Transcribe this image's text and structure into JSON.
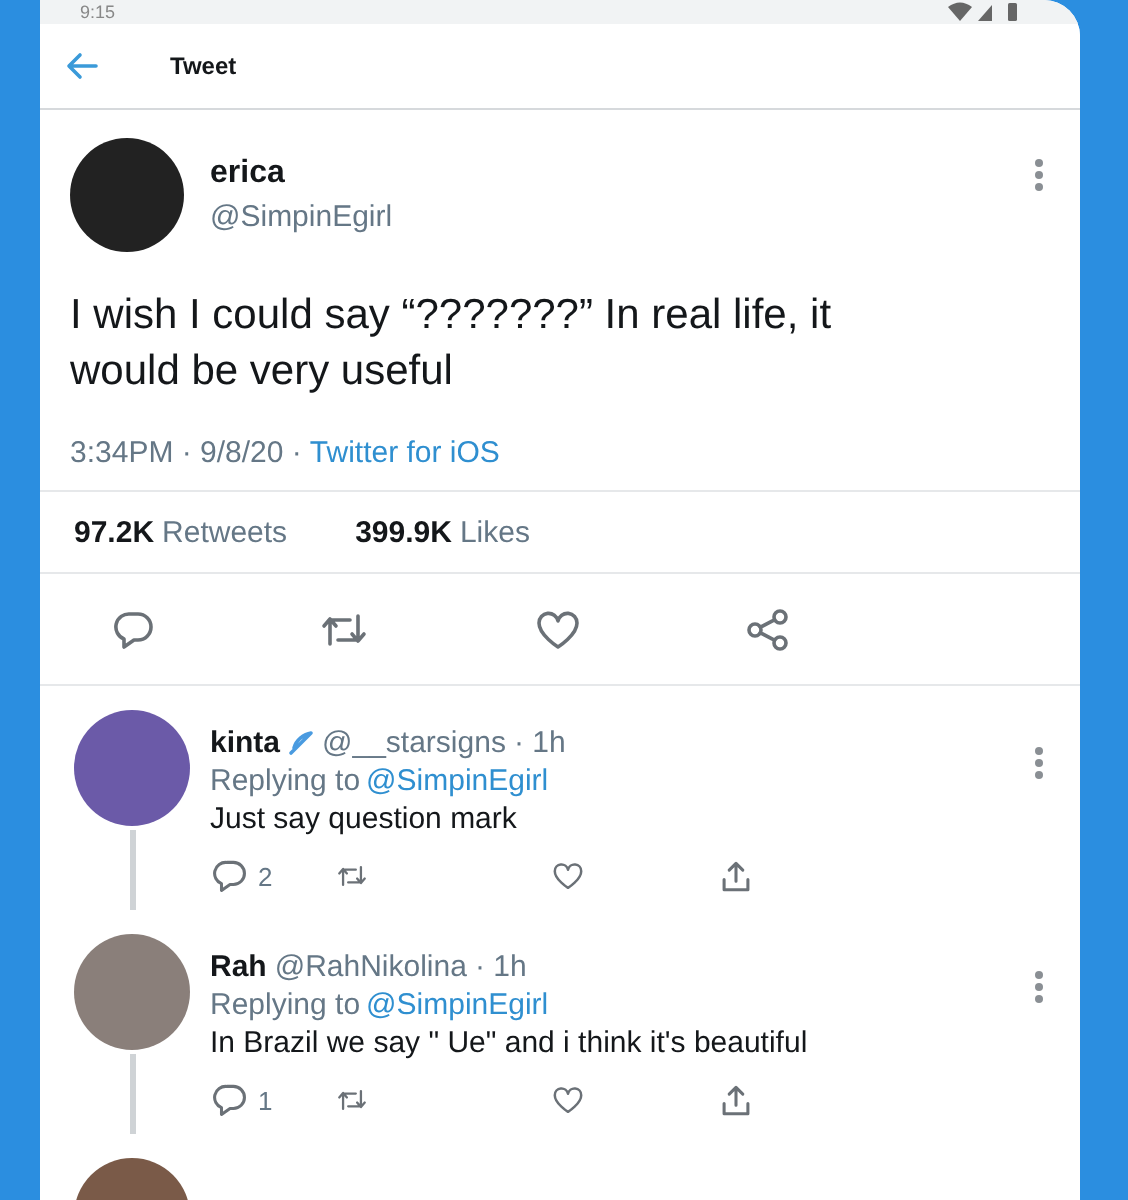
{
  "status_bar": {
    "time": "9:15"
  },
  "header": {
    "title": "Tweet"
  },
  "tweet": {
    "name": "erica",
    "handle": "@SimpinEgirl",
    "text": "I wish I could say “???????” In real life, it would be very useful",
    "time": "3:34PM · 9/8/20 ·",
    "source": "Twitter for iOS",
    "stats": [
      {
        "count": "97.2K",
        "label": "Retweets"
      },
      {
        "count": "399.9K",
        "label": "Likes"
      }
    ]
  },
  "replies": [
    {
      "name": "kinta",
      "badge": true,
      "handle": "@__starsigns",
      "time": "· 1h",
      "replying_prefix": "Replying to",
      "replying_to": "@SimpinEgirl",
      "text": "Just say question mark",
      "reply_count": "2"
    },
    {
      "name": "Rah",
      "badge": false,
      "handle": "@RahNikolina",
      "time": "· 1h",
      "replying_prefix": "Replying to",
      "replying_to": "@SimpinEgirl",
      "text": "In Brazil we say \" Ue\" and i think it's beautiful",
      "reply_count": "1"
    }
  ]
}
